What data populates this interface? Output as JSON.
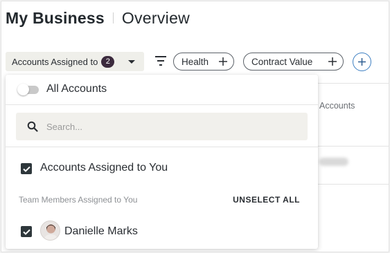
{
  "header": {
    "title": "My Business",
    "subtitle": "Overview"
  },
  "filters": {
    "assigned_label": "Accounts Assigned to",
    "assigned_count": "2",
    "pills": [
      {
        "label": "Health"
      },
      {
        "label": "Contract Value"
      }
    ]
  },
  "background": {
    "column_text": "Accounts"
  },
  "dropdown": {
    "all_accounts_label": "All Accounts",
    "all_accounts_enabled": false,
    "search": {
      "placeholder": "Search...",
      "value": ""
    },
    "assigned_to_you": {
      "label": "Accounts Assigned to You",
      "checked": true
    },
    "team_section_label": "Team Members Assigned to You",
    "unselect_all_label": "UNSELECT ALL",
    "team_members": [
      {
        "name": "Danielle Marks",
        "checked": true,
        "icon": "avatar"
      }
    ]
  },
  "colors": {
    "badge": "#3b2a3d",
    "checkbox": "#2e373b",
    "add_button_accent": "#3d7fc2"
  },
  "icons": {
    "filter": "filter-icon",
    "search": "search-icon",
    "dropdown": "chevron-down-icon",
    "add": "plus-icon"
  }
}
